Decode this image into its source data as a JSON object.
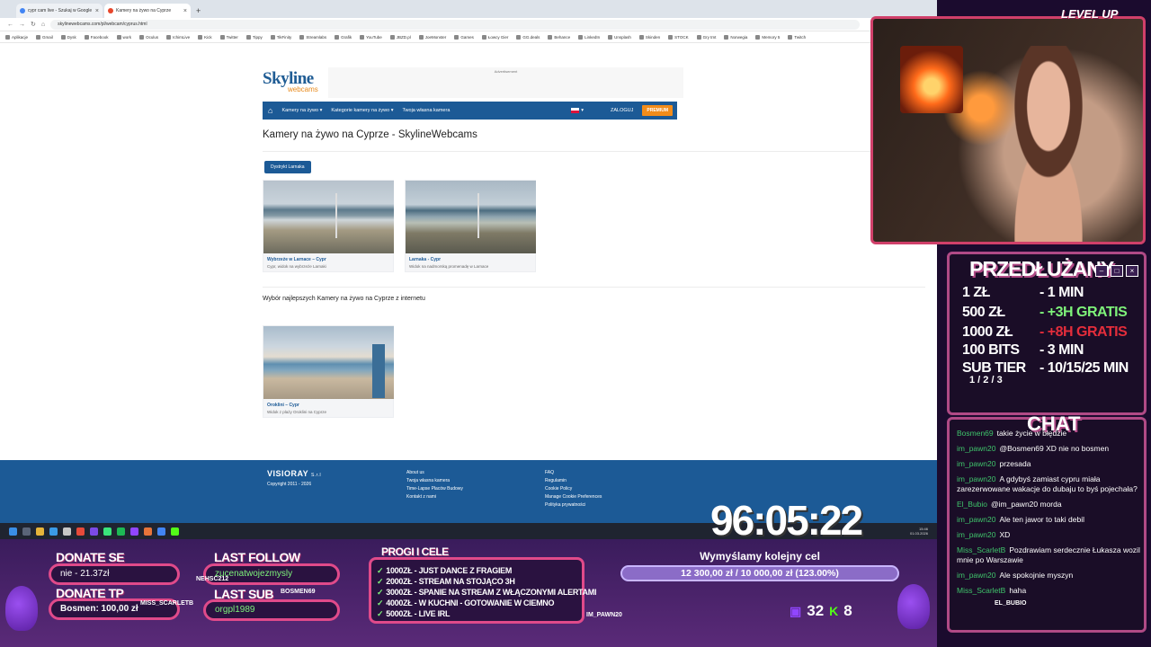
{
  "browser": {
    "tabs": [
      {
        "title": "cypr cam live - Szukaj w Google",
        "active": false
      },
      {
        "title": "Kamery na żywo na Cyprze",
        "active": true
      }
    ],
    "url": "skylinewebcams.com/pl/webcam/cyprus.html",
    "bookmarks": [
      "Aplikacje",
      "Gmail",
      "Dysk",
      "Facebook",
      "work",
      "Oculus",
      "IchimLive",
      "Kick",
      "Twitter",
      "Tippy",
      "TikFinity",
      "Streamlabs",
      "Grafik",
      "YouTube",
      "JBZD.pl",
      "JoeMonster",
      "Games",
      "Łowcy Gier",
      "GG.deals",
      "Behance",
      "LinkedIn",
      "Unsplash",
      "Skinden",
      "STOCK",
      "Gry tmt",
      "Norwegia",
      "Memory 5",
      "Twitch"
    ]
  },
  "site": {
    "logo_main": "Skyline",
    "logo_sub": "webcams",
    "ad_label": "Advertisement",
    "nav": {
      "live_cams": "Kamery na żywo ▾",
      "categories": "Kategorie kamery na żywo ▾",
      "own_cam": "Twoja własna kamera",
      "lang": "▾",
      "login": "ZALOGUJ",
      "premium": "PREMIUM"
    },
    "title": "Kamery na żywo na Cyprze - SkylineWebcams",
    "district_button": "Dystrykt Larnaka",
    "cards": [
      {
        "title": "Wybrzeże w Larnace – Cypr",
        "desc": "Cypr, widok na wybrzeże Larnaki"
      },
      {
        "title": "Larnaka - Cypr",
        "desc": "Widok na nadmorską promenadę w Larnace"
      },
      {
        "title": "Oroklini – Cypr",
        "desc": "Widok z plaży Oroklini na Cyprze"
      }
    ],
    "best_heading": "Wybór najlepszych Kamery na żywo na Cyprze z internetu",
    "footer": {
      "brand": "VISIORAY",
      "brand_suffix": "S.r.l",
      "copyright": "Copyright 2011 - 2026",
      "col1": [
        "About us",
        "Twoja własna kamera",
        "Time-Lapse Placów Budowy",
        "Kontakt z nami"
      ],
      "col2": [
        "FAQ",
        "Regulamin",
        "Cookie Policy",
        "Manage Cookie Preferences",
        "Polityka prywatności"
      ]
    }
  },
  "taskbar": {
    "time": "15:46",
    "date": "01.03.2026"
  },
  "overlay": {
    "level_up": "LEVEL UP",
    "extend": {
      "title": "PRZEDŁUŻANY",
      "rates": [
        {
          "amount": "1 ZŁ",
          "value": "- 1 MIN",
          "tone": "white"
        },
        {
          "amount": "500 ZŁ",
          "value": "- +3H GRATIS",
          "tone": "green"
        },
        {
          "amount": "1000 ZŁ",
          "value": "- +8H GRATIS",
          "tone": "red"
        },
        {
          "amount": "100 BITS",
          "value": "- 3 MIN",
          "tone": "white"
        },
        {
          "amount": "SUB TIER",
          "value": "- 10/15/25 MIN",
          "tone": "white"
        }
      ],
      "tier_note": "1 / 2 / 3"
    },
    "chat": {
      "title": "CHAT",
      "messages": [
        {
          "user": "Bosmen69",
          "text": "takie życie w błędzie"
        },
        {
          "user": "im_pawn20",
          "text": "@Bosmen69 XD nie no bosmen"
        },
        {
          "user": "im_pawn20",
          "text": "przesada"
        },
        {
          "user": "im_pawn20",
          "text": "A gdybyś zamiast cypru miała zarezerwowane wakacje do dubaju to byś pojechała?"
        },
        {
          "user": "El_Bubio",
          "text": "@im_pawn20 morda"
        },
        {
          "user": "im_pawn20",
          "text": "Ale ten jawor to taki debil"
        },
        {
          "user": "im_pawn20",
          "text": "XD"
        },
        {
          "user": "Miss_ScarletB",
          "text": "Pozdrawiam serdecznie Łukasza wozil mnie po Warszawie"
        },
        {
          "user": "im_pawn20",
          "text": "Ale spokojnie myszyn"
        },
        {
          "user": "Miss_ScarletB",
          "text": "haha"
        }
      ]
    },
    "timer": "96:05:22",
    "donate_se": {
      "label": "DONATE SE",
      "value": "nie - 21.37zł"
    },
    "donate_tp": {
      "label": "DONATE TP",
      "value": "Bosmen: 100,00 zł"
    },
    "last_follow": {
      "label": "LAST FOLLOW",
      "value": "zucenatwojezmysly"
    },
    "last_sub": {
      "label": "LAST SUB",
      "value": "orgpl1989"
    },
    "thresholds": {
      "title": "PROGI I CELE",
      "items": [
        "1000ZŁ - JUST DANCE Z FRAGIEM",
        "2000ZŁ - STREAM NA STOJĄCO 3H",
        "3000ZŁ - SPANIE NA STREAM Z WŁĄCZONYMI ALERTAMI",
        "4000ZŁ - W KUCHNI - GOTOWANIE W CIEMNO",
        "5000ZŁ - LIVE IRL"
      ]
    },
    "goal": {
      "title": "Wymyślamy kolejny cel",
      "progress": "12 300,00 zł / 10 000,00 zł (123.00%)"
    },
    "viewers": {
      "twitch": "32",
      "kick": "8"
    },
    "names": [
      "NEHSC212",
      "MISS_SCARLETB",
      "BOSMEN69",
      "IM_PAWN20",
      "EL_BUBIO"
    ]
  }
}
